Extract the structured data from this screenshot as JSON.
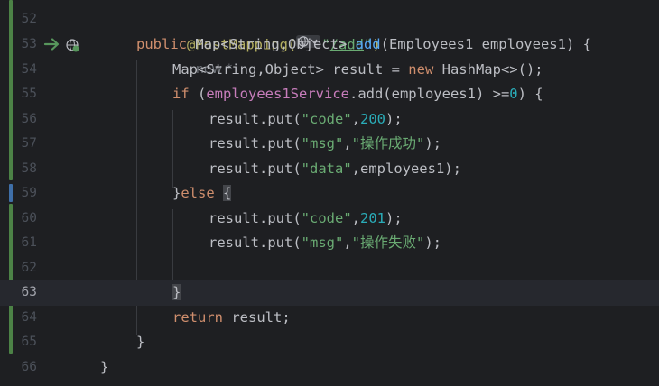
{
  "editor": {
    "colors": {
      "background": "#1e1f22",
      "keyword": "#cf8e6d",
      "annotation": "#b3ae60",
      "string": "#6aab73",
      "number": "#2aacb8",
      "method": "#56a8f5",
      "field": "#c77dbb",
      "text": "#bcbec4"
    },
    "current_line": "63",
    "lines": [
      {
        "num": "52"
      },
      {
        "num": "53"
      },
      {
        "num": "54"
      },
      {
        "num": "55"
      },
      {
        "num": "56"
      },
      {
        "num": "57"
      },
      {
        "num": "58"
      },
      {
        "num": "59"
      },
      {
        "num": "60"
      },
      {
        "num": "61"
      },
      {
        "num": "62"
      },
      {
        "num": "63"
      },
      {
        "num": "64"
      },
      {
        "num": "65"
      },
      {
        "num": "66"
      }
    ],
    "tokens": {
      "l52_ann": "@PostMapping(",
      "l52_str_open": "\"",
      "l52_path": "/add",
      "l52_str_close": "\"",
      "l52_paren": ")",
      "l52_hint": "new *",
      "l53_kw": "public ",
      "l53_type": "Map<String,Object> ",
      "l53_fn": "add",
      "l53_rest": "(Employees1 employees1) {",
      "l54_a": "Map<String,Object> result = ",
      "l54_kw": "new ",
      "l54_b": "HashMap<>();",
      "l55_kw": "if ",
      "l55_a": "(",
      "l55_field": "employees1Service",
      "l55_b": ".add(employees1) >=",
      "l55_num": "0",
      "l55_c": ") {",
      "l56_a": "result.put(",
      "l56_str": "\"code\"",
      "l56_b": ",",
      "l56_num": "200",
      "l56_c": ");",
      "l57_a": "result.put(",
      "l57_str1": "\"msg\"",
      "l57_b": ",",
      "l57_str2": "\"操作成功\"",
      "l57_c": ");",
      "l58_a": "result.put(",
      "l58_str": "\"data\"",
      "l58_b": ",employees1);",
      "l59_a": "}",
      "l59_kw": "else ",
      "l59_b": "{",
      "l60_a": "result.put(",
      "l60_str": "\"code\"",
      "l60_b": ",",
      "l60_num": "201",
      "l60_c": ");",
      "l61_a": "result.put(",
      "l61_str1": "\"msg\"",
      "l61_b": ",",
      "l61_str2": "\"操作失败\"",
      "l61_c": ");",
      "l63_a": "}",
      "l64_kw": "return ",
      "l64_a": "result;",
      "l65_a": "}",
      "l66_a": "}"
    },
    "icons": {
      "run": "run-arrow-icon",
      "endpoint": "web-endpoint-icon",
      "globe": "globe-icon"
    }
  }
}
